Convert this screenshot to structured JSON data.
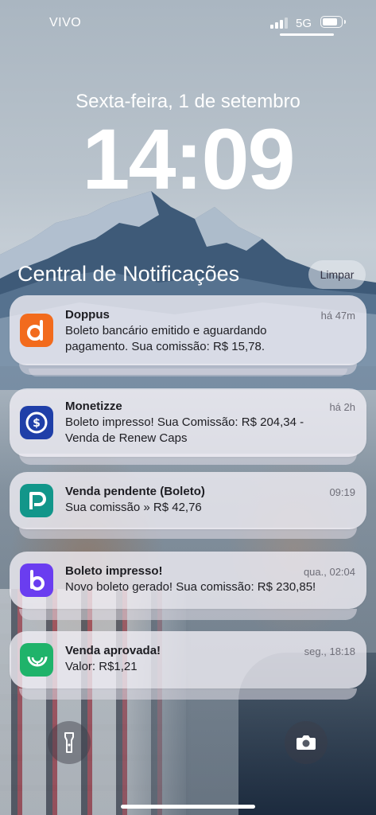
{
  "status_bar": {
    "carrier": "VIVO",
    "network": "5G",
    "signal_icon": "cellular-signal-icon",
    "battery_icon": "battery-icon",
    "battery_level": 0.85
  },
  "lock_screen": {
    "date": "Sexta-feira, 1 de setembro",
    "time": "14:09"
  },
  "notification_center": {
    "title": "Central de Notificações",
    "clear_label": "Limpar"
  },
  "notifications": [
    {
      "title": "Doppus",
      "time": "há 47m",
      "line1": "Boleto bancário emitido e aguardando",
      "line2": "pagamento. Sua comissão: R$ 15,78.",
      "icon": "doppus-app-icon",
      "color": "#f26b1d"
    },
    {
      "title": "Monetizze",
      "time": "há 2h",
      "line1": "Boleto impresso! Sua Comissão: R$ 204,34 -",
      "line2": "Venda de Renew Caps",
      "icon": "monetizze-app-icon",
      "color": "#1f3fa8"
    },
    {
      "title": "Venda pendente (Boleto)",
      "time": "09:19",
      "line1": "Sua comissão » R$ 42,76",
      "icon": "payment-app-icon",
      "color": "#12968a"
    },
    {
      "title": "Boleto impresso!",
      "time": "qua., 02:04",
      "line1": "Novo boleto gerado! Sua comissão: R$ 230,85!",
      "icon": "braip-app-icon",
      "color": "#6a3df0"
    },
    {
      "title": "Venda aprovada!",
      "time": "seg., 18:18",
      "line1": "Valor: R$1,21",
      "icon": "kiwify-app-icon",
      "color": "#1fb36a"
    }
  ],
  "bottom_controls": {
    "flashlight_icon": "flashlight-icon",
    "camera_icon": "camera-icon"
  }
}
